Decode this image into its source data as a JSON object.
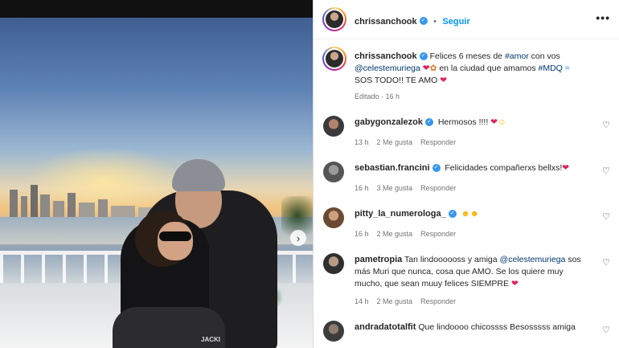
{
  "post": {
    "username": "chrissanchook",
    "follow_label": "Seguir",
    "more_label": "•••",
    "photo_bag_text": "JACKI"
  },
  "caption": {
    "username": "chrissanchook",
    "text_1": "Felices 6 meses de ",
    "tag_1": "#amor",
    "text_2": " con vos ",
    "mention": "@celestemuriega",
    "text_3": " en la ciudad que amamos ",
    "tag_2": "#MDQ",
    "text_4": "SOS TODO!! TE AMO",
    "edited": "Editado",
    "time": "16 h"
  },
  "comments": [
    {
      "username": "gabygonzalezok",
      "verified": true,
      "text": "Hermosos !!!! ",
      "time": "13 h",
      "likes": "2 Me gusta",
      "reply": "Responder"
    },
    {
      "username": "sebastian.francini",
      "verified": true,
      "text": "Felicidades compañerxs bellxs!",
      "time": "16 h",
      "likes": "3 Me gusta",
      "reply": "Responder"
    },
    {
      "username": "pitty_la_numerologa_",
      "verified": true,
      "text": "",
      "time": "16 h",
      "likes": "2 Me gusta",
      "reply": "Responder"
    },
    {
      "username": "pametropia",
      "verified": false,
      "text_1": "Tan lindoooooss y amiga ",
      "mention": "@celestemuriega",
      "text_2": " sos más Muri que nunca, cosa que AMO. Se los quiere muy mucho, que sean muuy felices SIEMPRE",
      "time": "14 h",
      "likes": "2 Me gusta",
      "reply": "Responder"
    },
    {
      "username": "andradatotalfit",
      "verified": false,
      "text": "Que lindoooo chicossss Besosssss amiga"
    }
  ],
  "icons": {
    "verified": "verified-badge-icon",
    "heart": "heart-outline-icon",
    "next": "chevron-right-icon"
  }
}
